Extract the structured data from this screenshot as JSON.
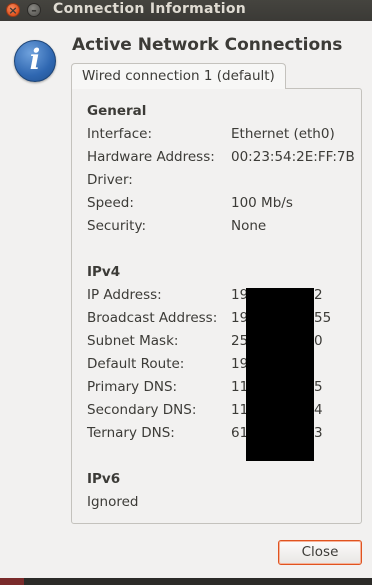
{
  "window": {
    "title": "Connection Information",
    "close_glyph": "×",
    "minimize_glyph": "–"
  },
  "header": {
    "icon": "info-icon",
    "icon_glyph": "i",
    "heading": "Active Network Connections"
  },
  "tab": {
    "label": "Wired connection 1 (default)"
  },
  "general": {
    "title": "General",
    "rows": [
      {
        "label": "Interface:",
        "value": "Ethernet (eth0)"
      },
      {
        "label": "Hardware Address:",
        "value": "00:23:54:2E:FF:7B"
      },
      {
        "label": "Driver:",
        "value": ""
      },
      {
        "label": "Speed:",
        "value": "100 Mb/s"
      },
      {
        "label": "Security:",
        "value": "None"
      }
    ]
  },
  "ipv4": {
    "title": "IPv4",
    "rows": [
      {
        "label": "IP Address:",
        "value": "19",
        "suffix": "2"
      },
      {
        "label": "Broadcast Address:",
        "value": "19",
        "suffix": "55"
      },
      {
        "label": "Subnet Mask:",
        "value": "25",
        "suffix": "0"
      },
      {
        "label": "Default Route:",
        "value": "19",
        "suffix": ""
      },
      {
        "label": "Primary DNS:",
        "value": "11",
        "suffix": "5"
      },
      {
        "label": "Secondary DNS:",
        "value": "11",
        "suffix": "4"
      },
      {
        "label": "Ternary DNS:",
        "value": "61",
        "suffix": "3"
      }
    ]
  },
  "ipv6": {
    "title": "IPv6",
    "status": "Ignored"
  },
  "footer": {
    "close_label": "Close"
  },
  "colors": {
    "accent": "#e0531f",
    "titlebar": "#3c3b37",
    "window_bg": "#f2f1f0",
    "icon_blue": "#2f67b1"
  }
}
